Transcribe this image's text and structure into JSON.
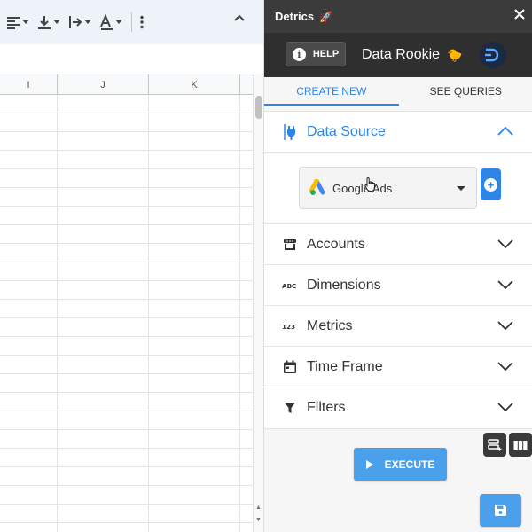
{
  "sheet": {
    "columns": [
      "I",
      "J",
      "K"
    ]
  },
  "panel": {
    "title": "Detrics",
    "help_label": "HELP",
    "user_level": "Data Rookie",
    "tabs": [
      {
        "label": "CREATE NEW",
        "active": true
      },
      {
        "label": "SEE QUERIES",
        "active": false
      }
    ],
    "sections": [
      {
        "label": "Data Source",
        "icon": "plug-icon",
        "open": true
      },
      {
        "label": "Accounts",
        "icon": "store-icon",
        "open": false
      },
      {
        "label": "Dimensions",
        "icon": "abc-icon",
        "open": false
      },
      {
        "label": "Metrics",
        "icon": "123-icon",
        "open": false
      },
      {
        "label": "Time Frame",
        "icon": "calendar-icon",
        "open": false
      },
      {
        "label": "Filters",
        "icon": "funnel-icon",
        "open": false
      }
    ],
    "data_source": {
      "selected": "Google Ads"
    },
    "execute_label": "EXECUTE"
  },
  "colors": {
    "accent": "#2f85e6",
    "button": "#4aa0ea",
    "titlebar": "#3b3b3b",
    "subheader": "#2f2f2f"
  }
}
